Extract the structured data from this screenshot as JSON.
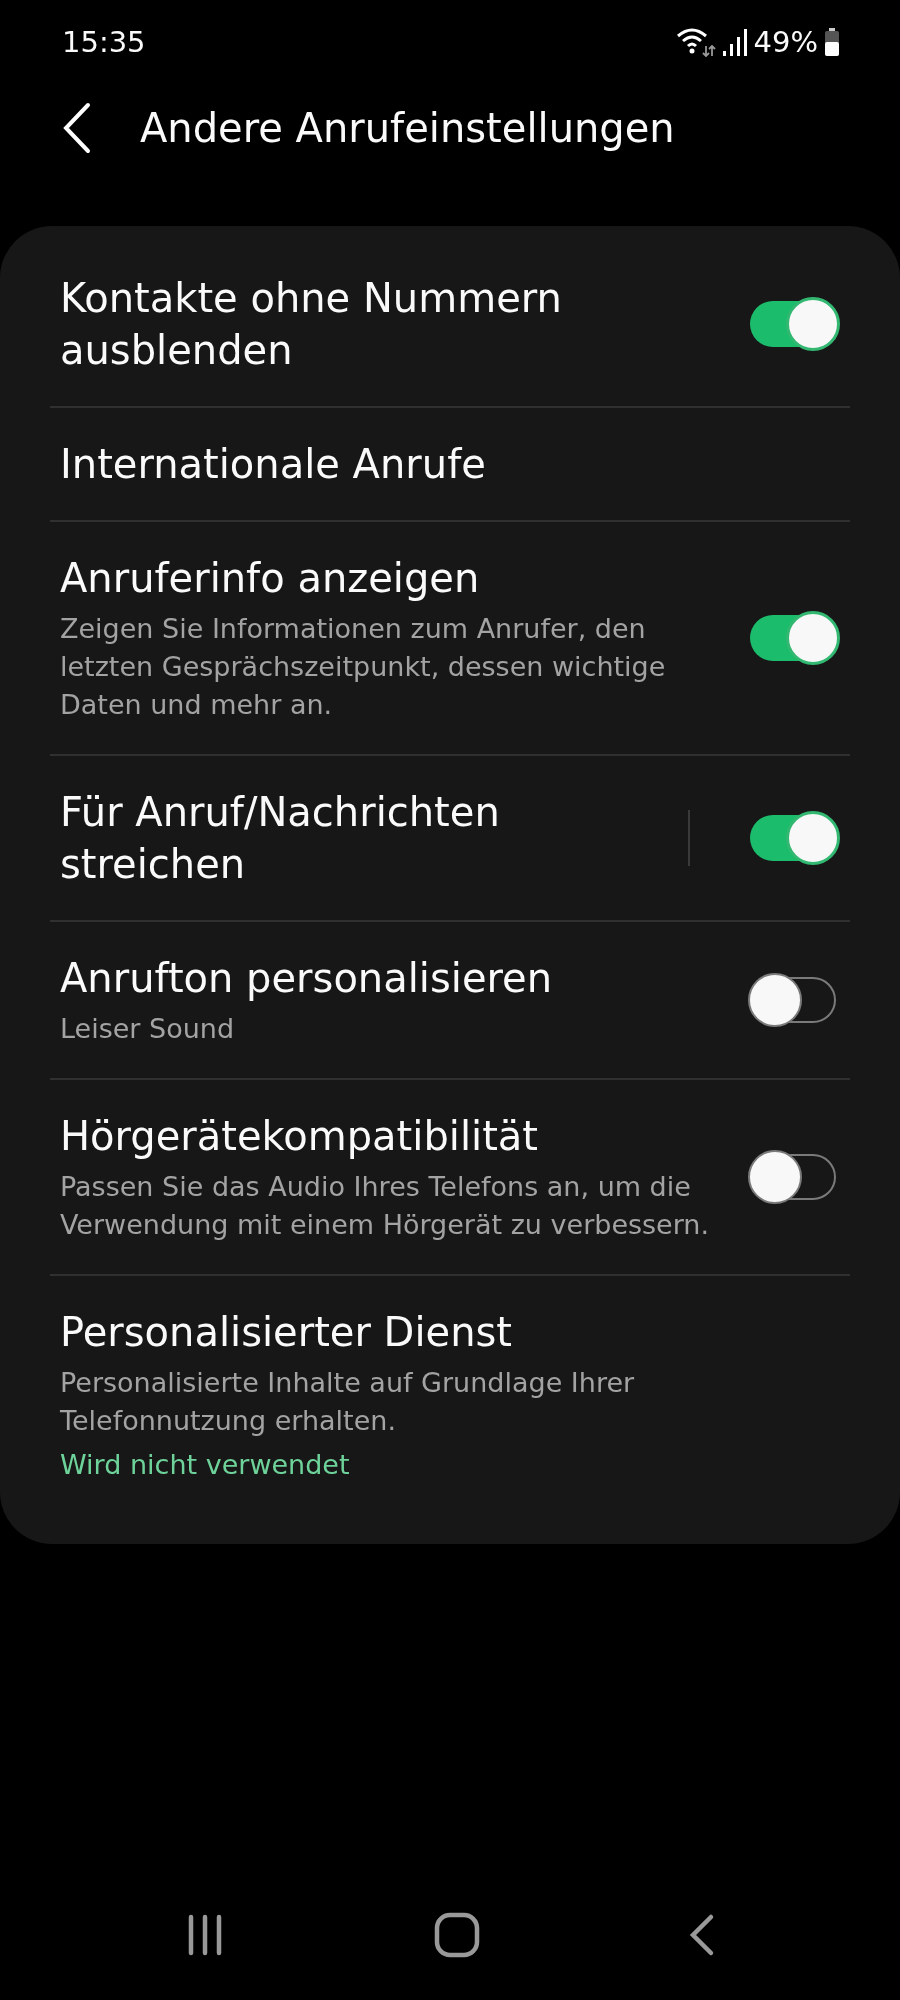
{
  "status_bar": {
    "time": "15:35",
    "battery_text": "49%"
  },
  "header": {
    "title": "Andere Anrufeinstellungen"
  },
  "settings": [
    {
      "kind": "toggle",
      "title": "Kontakte ohne Nummern ausblenden",
      "on": true
    },
    {
      "kind": "link",
      "title": "Internationale Anrufe"
    },
    {
      "kind": "toggle",
      "title": "Anruferinfo anzeigen",
      "summary": "Zeigen Sie Informationen zum Anrufer, den letzten Gesprächszeitpunkt, dessen wichtige Daten und mehr an.",
      "on": true
    },
    {
      "kind": "split_toggle",
      "title": "Für Anruf/Nachrichten streichen",
      "on": true
    },
    {
      "kind": "toggle",
      "title": "Anrufton personalisieren",
      "summary": "Leiser Sound",
      "on": false
    },
    {
      "kind": "toggle",
      "title": "Hörgerätekompatibilität",
      "summary": "Passen Sie das Audio Ihres Telefons an, um die Verwendung mit einem Hörgerät zu verbessern.",
      "on": false
    },
    {
      "kind": "link",
      "title": "Personalisierter Dienst",
      "summary": "Personalisierte Inhalte auf Grundlage Ihrer Telefonnutzung erhalten.",
      "status": "Wird nicht verwendet"
    }
  ]
}
